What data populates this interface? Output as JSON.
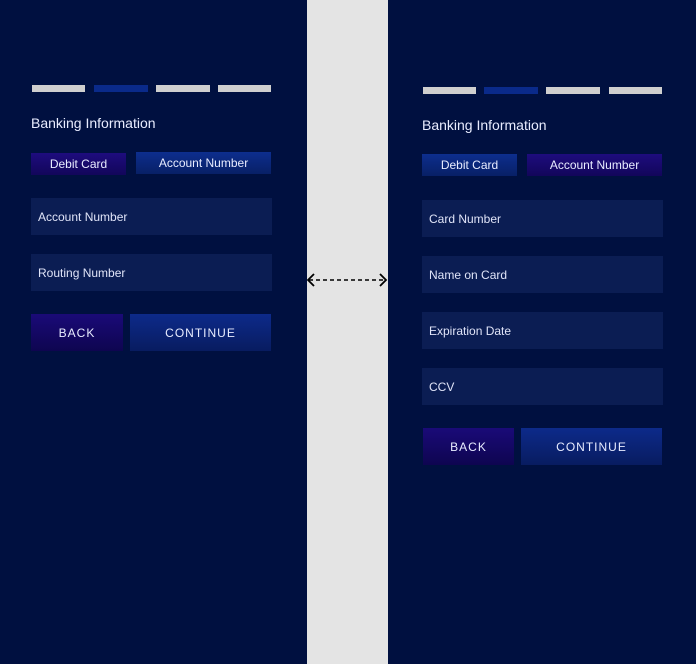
{
  "left_panel": {
    "title": "Banking Information",
    "tabs": [
      {
        "label": "Debit Card"
      },
      {
        "label": "Account Number"
      }
    ],
    "fields": [
      {
        "placeholder": "Account Number"
      },
      {
        "placeholder": "Routing Number"
      }
    ],
    "buttons": {
      "back": "BACK",
      "continue": "CONTINUE"
    },
    "progress": {
      "total_steps": 4,
      "active_step": 2
    }
  },
  "right_panel": {
    "title": "Banking Information",
    "tabs": [
      {
        "label": "Debit Card"
      },
      {
        "label": "Account Number"
      }
    ],
    "fields": [
      {
        "placeholder": "Card Number"
      },
      {
        "placeholder": "Name on Card"
      },
      {
        "placeholder": "Expiration Date"
      },
      {
        "placeholder": "CCV"
      }
    ],
    "buttons": {
      "back": "BACK",
      "continue": "CONTINUE"
    },
    "progress": {
      "total_steps": 4,
      "active_step": 2
    }
  },
  "connector": {
    "icon": "double-arrow-icon"
  },
  "colors": {
    "panel_bg": "#001040",
    "field_bg": "#0b1d53",
    "accent_purple": "#1a0a78",
    "accent_blue": "#0d2a8a",
    "gutter": "#e4e4e4"
  }
}
